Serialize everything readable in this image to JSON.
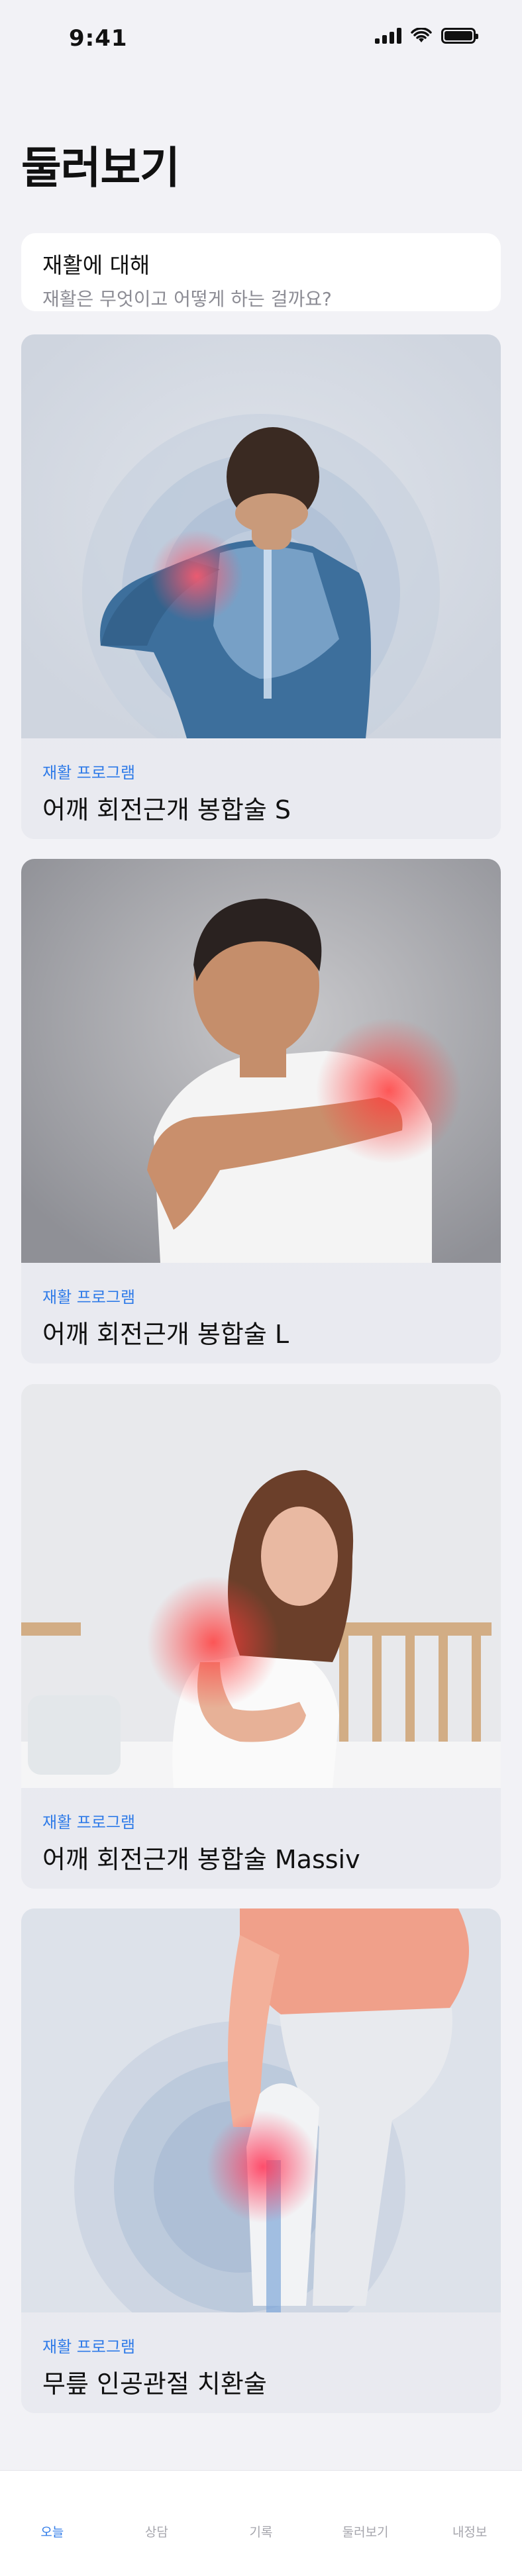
{
  "status_bar": {
    "time": "9:41"
  },
  "page_title": "둘러보기",
  "about": {
    "title": "재활에 대해",
    "subtitle": "재활은 무엇이고 어떻게 하는 걸까요?"
  },
  "programs": [
    {
      "category": "재활 프로그램",
      "name": "어깨 회전근개 봉합술 S",
      "image_icon": "shoulder-xray-back-icon"
    },
    {
      "category": "재활 프로그램",
      "name": "어깨 회전근개 봉합술 L",
      "image_icon": "shoulder-pain-man-icon"
    },
    {
      "category": "재활 프로그램",
      "name": "어깨 회전근개 봉합술 Massiv",
      "image_icon": "shoulder-pain-woman-icon"
    },
    {
      "category": "재활 프로그램",
      "name": "무릎 인공관절 치환술",
      "image_icon": "knee-xray-icon"
    }
  ],
  "tab_bar": {
    "items": [
      {
        "label": "오늘"
      },
      {
        "label": "상담"
      },
      {
        "label": "기록"
      },
      {
        "label": "둘러보기"
      },
      {
        "label": "내정보"
      }
    ],
    "active_index": 0
  },
  "colors": {
    "accent": "#2f7be8",
    "background": "#f2f2f6",
    "pain_highlight": "#ff3b3b"
  }
}
